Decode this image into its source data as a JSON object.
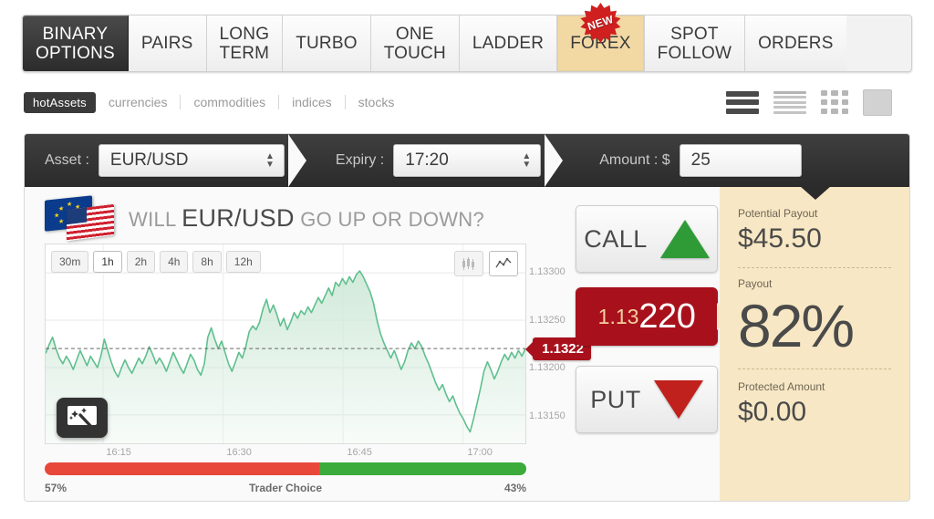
{
  "nav": {
    "tabs": [
      {
        "label": "BINARY\nOPTIONS",
        "state": "active-dark",
        "badge": null
      },
      {
        "label": "PAIRS",
        "state": "normal",
        "badge": null
      },
      {
        "label": "LONG\nTERM",
        "state": "normal",
        "badge": null
      },
      {
        "label": "TURBO",
        "state": "normal",
        "badge": null
      },
      {
        "label": "ONE\nTOUCH",
        "state": "normal",
        "badge": null
      },
      {
        "label": "LADDER",
        "state": "normal",
        "badge": null
      },
      {
        "label": "FOREX",
        "state": "active-gold",
        "badge": "NEW"
      },
      {
        "label": "SPOT\nFOLLOW",
        "state": "normal",
        "badge": null
      },
      {
        "label": "ORDERS",
        "state": "normal",
        "badge": null
      }
    ]
  },
  "filters": {
    "active_chip": "hotAssets",
    "links": [
      "currencies",
      "commodities",
      "indices",
      "stocks"
    ],
    "view_icons": [
      "list-dark-icon",
      "list-light-icon",
      "grid-icon",
      "single-box-icon"
    ]
  },
  "selection": {
    "asset_label": "Asset :",
    "asset_value": "EUR/USD",
    "expiry_label": "Expiry :",
    "expiry_value": "17:20",
    "amount_label": "Amount : $",
    "amount_value": "25"
  },
  "headline": {
    "prefix": "WILL",
    "asset": "EUR/USD",
    "suffix": "GO UP OR DOWN?"
  },
  "chart_controls": {
    "timeframes": [
      {
        "label": "30m",
        "active": false
      },
      {
        "label": "1h",
        "active": true
      },
      {
        "label": "2h",
        "active": false
      },
      {
        "label": "4h",
        "active": false
      },
      {
        "label": "8h",
        "active": false
      },
      {
        "label": "12h",
        "active": false
      }
    ],
    "types": [
      {
        "name": "candlestick-chart-icon",
        "active": false
      },
      {
        "name": "line-chart-icon",
        "active": true
      }
    ],
    "wand_icon": "magic-wand-screen-icon"
  },
  "chart_data": {
    "type": "area",
    "title": "",
    "xlabel": "",
    "ylabel": "",
    "series_name": "EUR/USD",
    "line_color": "#5fbf8e",
    "fill_color": "#cfe9d8",
    "ylim": [
      1.1312,
      1.1333
    ],
    "yticks": [
      "1.13300",
      "1.13250",
      "1.13200",
      "1.13150"
    ],
    "ytick_values": [
      1.133,
      1.1325,
      1.132,
      1.1315
    ],
    "xticks": [
      "16:15",
      "16:30",
      "16:45",
      "17:00"
    ],
    "xtick_positions": [
      0.12,
      0.37,
      0.62,
      0.87
    ],
    "grid": true,
    "current_price_label": "1.1322",
    "current_price_value": 1.1322,
    "marker_color": "#a8111c",
    "values": [
      1.13215,
      1.13224,
      1.13232,
      1.1322,
      1.1321,
      1.13204,
      1.13212,
      1.13206,
      1.13198,
      1.13208,
      1.13218,
      1.1321,
      1.13202,
      1.13212,
      1.13206,
      1.132,
      1.13212,
      1.1323,
      1.13218,
      1.13206,
      1.13196,
      1.1319,
      1.132,
      1.13208,
      1.132,
      1.13194,
      1.13202,
      1.1321,
      1.13204,
      1.13212,
      1.13222,
      1.13214,
      1.13204,
      1.1321,
      1.13204,
      1.13196,
      1.13206,
      1.13216,
      1.13208,
      1.132,
      1.13194,
      1.13204,
      1.13214,
      1.13208,
      1.13198,
      1.13192,
      1.13204,
      1.13232,
      1.13242,
      1.1323,
      1.1322,
      1.13228,
      1.13216,
      1.13204,
      1.13196,
      1.13206,
      1.13216,
      1.1321,
      1.13222,
      1.13238,
      1.13244,
      1.1324,
      1.13248,
      1.13262,
      1.13272,
      1.13258,
      1.13266,
      1.13256,
      1.13244,
      1.13252,
      1.1324,
      1.13248,
      1.13258,
      1.13252,
      1.1326,
      1.13256,
      1.13264,
      1.13258,
      1.13266,
      1.13274,
      1.13268,
      1.13276,
      1.13284,
      1.13276,
      1.1329,
      1.13286,
      1.13294,
      1.13288,
      1.13296,
      1.1329,
      1.13298,
      1.13302,
      1.13296,
      1.13288,
      1.1328,
      1.13268,
      1.1325,
      1.13236,
      1.13226,
      1.13218,
      1.1321,
      1.13218,
      1.13208,
      1.13198,
      1.13206,
      1.13218,
      1.13226,
      1.1322,
      1.13228,
      1.13222,
      1.13212,
      1.13204,
      1.13194,
      1.13184,
      1.13176,
      1.13182,
      1.13172,
      1.13164,
      1.1317,
      1.1316,
      1.13152,
      1.13146,
      1.13138,
      1.13132,
      1.13146,
      1.13162,
      1.13178,
      1.13196,
      1.13206,
      1.13198,
      1.13188,
      1.13196,
      1.13206,
      1.13214,
      1.13208,
      1.13216,
      1.1321,
      1.13218,
      1.13212,
      1.1322
    ]
  },
  "trader_choice": {
    "label": "Trader Choice",
    "left_percent": "57%",
    "right_percent": "43%",
    "left_value": 57,
    "right_value": 43,
    "left_color": "#e8483a",
    "right_color": "#3bab3b"
  },
  "actions": {
    "call_label": "CALL",
    "put_label": "PUT",
    "price_small": "1.13",
    "price_large": "220"
  },
  "payout": {
    "potential_label": "Potential Payout",
    "potential_value": "$45.50",
    "payout_label": "Payout",
    "payout_value": "82%",
    "protected_label": "Protected Amount",
    "protected_value": "$0.00"
  }
}
